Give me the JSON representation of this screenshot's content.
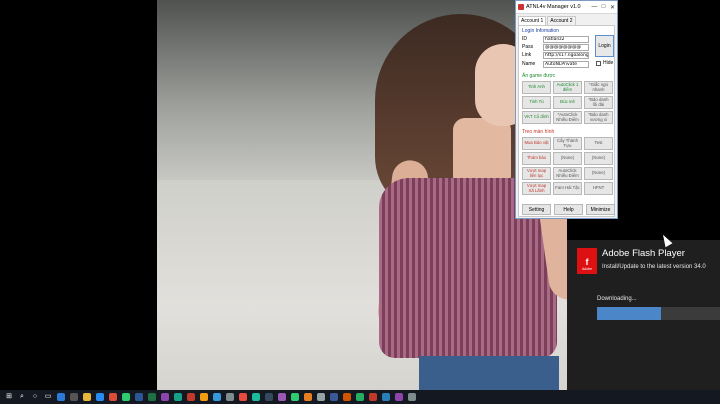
{
  "window": {
    "title": "ATNL4v Manager v1.0",
    "minimize": "—",
    "maximize": "□",
    "close": "✕",
    "tabs": [
      "Account 1",
      "Account 2"
    ]
  },
  "login": {
    "section_label": "Login Infomation",
    "id_label": "ID",
    "id_value": "hatlanz2",
    "pass_label": "Pass",
    "pass_value": "@@@@@@@@",
    "link_label": "Link",
    "link_value": "http://s1?.ngoalong",
    "name_label": "Name",
    "name_value": "AutoNLPrivate",
    "login_button": "Login",
    "hide_label": "Hide"
  },
  "game_section": {
    "label": "Ẩn game được",
    "buttons": [
      "Tinh Anh",
      "AutoClick 1 điểm",
      "*Giấc ngủ nhanh",
      "Tinh Tú",
      "Đúc mê",
      "*Bảo danh lồi đài",
      "VKT Cổ đính",
      "*AutoClick Nhiều Điểm",
      "*Bảo danh vương xi"
    ]
  },
  "screen_section": {
    "label": "Treo màn hình",
    "buttons": [
      "Mua Bảo vật",
      "Cây Thành Tựu",
      "Test",
      "Thám bảo",
      "(None)",
      "(None)",
      "Vượt map liên tục",
      "AutoClick Nhiều Điểm",
      "(None)",
      "Vượt map Xã Lãnh",
      "Fam Hải Tặc",
      "HFNT"
    ]
  },
  "bottom_buttons": [
    "Setting",
    "Help",
    "Minimize"
  ],
  "flash": {
    "logo_glyph": "f",
    "logo_text": "Adobe",
    "title": "Adobe Flash Player",
    "subtitle": "Install/Update to the latest version 34.0",
    "status": "Downloading...",
    "progress": 0.52
  },
  "colors": {
    "accent_blue": "#4a86c8",
    "flash_red": "#dd1111",
    "taskbar": "#141821"
  },
  "taskbar": {
    "icons": [
      {
        "name": "start-icon",
        "glyph": "⊞",
        "color": "#ffffff"
      },
      {
        "name": "search-icon",
        "glyph": "⌕",
        "color": "#ffffff"
      },
      {
        "name": "cortana-icon",
        "glyph": "○",
        "color": "#ffffff"
      },
      {
        "name": "task-view-icon",
        "glyph": "▭",
        "color": "#ffffff"
      },
      {
        "name": "edge-icon",
        "glyph": "",
        "color": "#2b7bd6"
      },
      {
        "name": "store-icon",
        "glyph": "",
        "color": "#555555"
      },
      {
        "name": "file-explorer-icon",
        "glyph": "",
        "color": "#e8b83a"
      },
      {
        "name": "messenger-icon",
        "glyph": "",
        "color": "#2a8cf0"
      },
      {
        "name": "chrome-icon",
        "glyph": "",
        "color": "#dd4b39"
      },
      {
        "name": "whatsapp-icon",
        "glyph": "",
        "color": "#2ecc71"
      },
      {
        "name": "word-icon",
        "glyph": "",
        "color": "#2b5797"
      },
      {
        "name": "excel-icon",
        "glyph": "",
        "color": "#1e7145"
      },
      {
        "name": "app-icon-1",
        "glyph": "",
        "color": "#8e44ad"
      },
      {
        "name": "app-icon-2",
        "glyph": "",
        "color": "#16a085"
      },
      {
        "name": "app-icon-3",
        "glyph": "",
        "color": "#c0392b"
      },
      {
        "name": "app-icon-4",
        "glyph": "",
        "color": "#f39c12"
      },
      {
        "name": "app-icon-5",
        "glyph": "",
        "color": "#3498db"
      },
      {
        "name": "app-icon-6",
        "glyph": "",
        "color": "#7f8c8d"
      },
      {
        "name": "app-icon-7",
        "glyph": "",
        "color": "#e74c3c"
      },
      {
        "name": "app-icon-8",
        "glyph": "",
        "color": "#1abc9c"
      },
      {
        "name": "app-icon-9",
        "glyph": "",
        "color": "#34495e"
      },
      {
        "name": "app-icon-10",
        "glyph": "",
        "color": "#9b59b6"
      },
      {
        "name": "app-icon-11",
        "glyph": "",
        "color": "#2ecc71"
      },
      {
        "name": "app-icon-12",
        "glyph": "",
        "color": "#e67e22"
      },
      {
        "name": "app-icon-13",
        "glyph": "",
        "color": "#95a5a6"
      },
      {
        "name": "app-icon-14",
        "glyph": "",
        "color": "#3b5998"
      },
      {
        "name": "app-icon-15",
        "glyph": "",
        "color": "#d35400"
      },
      {
        "name": "app-icon-16",
        "glyph": "",
        "color": "#27ae60"
      },
      {
        "name": "app-icon-17",
        "glyph": "",
        "color": "#c0392b"
      },
      {
        "name": "app-icon-18",
        "glyph": "",
        "color": "#2980b9"
      },
      {
        "name": "app-icon-19",
        "glyph": "",
        "color": "#8e44ad"
      },
      {
        "name": "app-icon-20",
        "glyph": "",
        "color": "#7f8c8d"
      }
    ]
  }
}
